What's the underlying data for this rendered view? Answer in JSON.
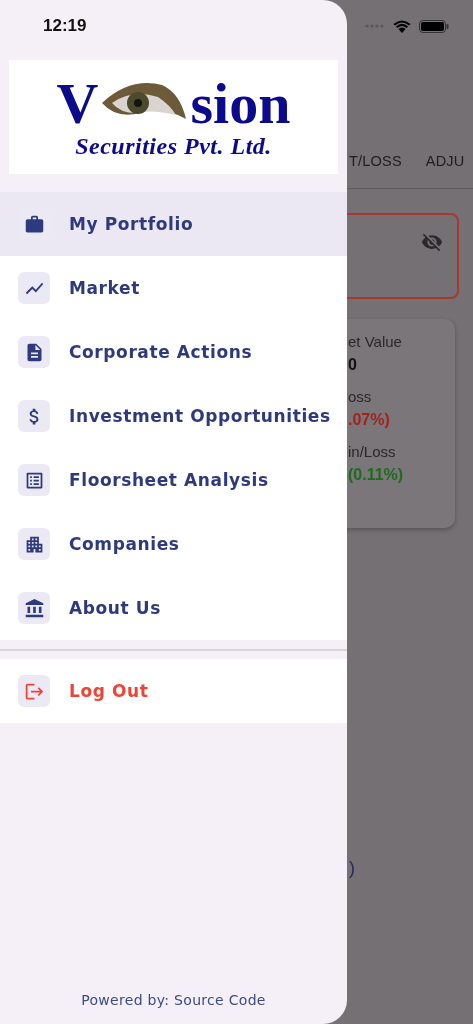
{
  "status_bar": {
    "time": "12:19"
  },
  "background": {
    "tabs": [
      {
        "label": "T/LOSS"
      },
      {
        "label": "ADJU"
      }
    ],
    "summary": {
      "lines": [
        {
          "text": "et Value",
          "kind": "label"
        },
        {
          "text": "0",
          "kind": "value"
        },
        {
          "text": "oss",
          "kind": "label"
        },
        {
          "text": ".07%)",
          "kind": "loss"
        },
        {
          "text": "in/Loss",
          "kind": "label"
        },
        {
          "text": "(0.11%)",
          "kind": "gain"
        }
      ]
    },
    "fragment": ")"
  },
  "logo": {
    "initial": "V",
    "rest": "sion",
    "subtitle": "Securities Pvt. Ltd."
  },
  "menu": [
    {
      "label": "My Portfolio",
      "selected": true
    },
    {
      "label": "Market",
      "selected": false
    },
    {
      "label": "Corporate Actions",
      "selected": false
    },
    {
      "label": "Investment Opportunities",
      "selected": false
    },
    {
      "label": "Floorsheet Analysis",
      "selected": false
    },
    {
      "label": "Companies",
      "selected": false
    },
    {
      "label": "About Us",
      "selected": false
    }
  ],
  "logout": {
    "label": "Log Out"
  },
  "footer": "Powered by: Source Code"
}
